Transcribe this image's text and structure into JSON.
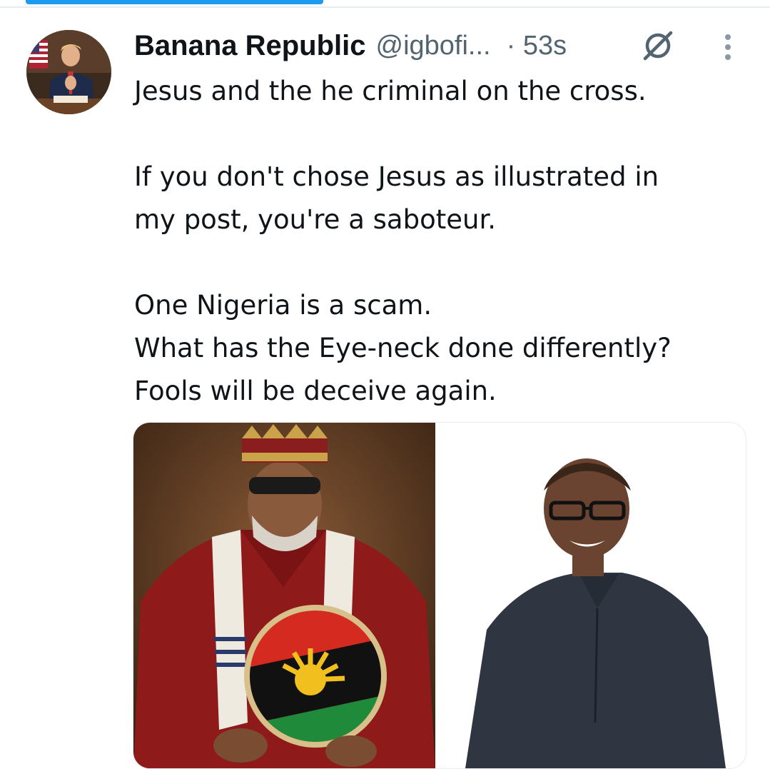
{
  "tweet": {
    "display_name": "Banana Republic",
    "handle": "@igbofi...",
    "timestamp": "· 53s",
    "lines": [
      "Jesus and the he criminal on the cross.",
      "",
      "If you don't chose Jesus as illustrated in",
      "my post, you're a saboteur.",
      "",
      "One Nigeria is a scam.",
      "What has the Eye-neck done differently?",
      "Fools will be deceive again."
    ]
  },
  "icons": {
    "grok": "grok-icon",
    "more": "more-vertical-icon"
  },
  "progress": {
    "fraction": 0.42,
    "color": "#1d9bf0"
  },
  "colors": {
    "text": "#0f1419",
    "secondary": "#536471",
    "accent": "#1d9bf0"
  }
}
